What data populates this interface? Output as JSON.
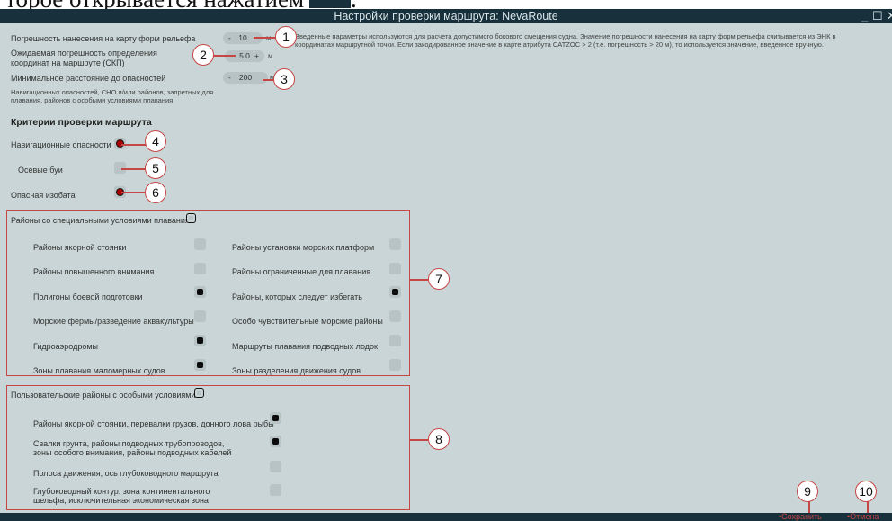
{
  "doc_text": "торое открывается нажатием",
  "window": {
    "title": "Настройки проверки маршрута: NevaRoute",
    "minimize": "_",
    "maximize": "☐",
    "close": "✕"
  },
  "params": {
    "relief": {
      "label": "Погрешность нанесения на карту форм рельефа",
      "value": "10",
      "unit": "м",
      "minus": "-",
      "plus": "+"
    },
    "position": {
      "label": "Ожидаемая погрешность определения координат на маршруте (СКП)",
      "value": "5.0",
      "unit": "м",
      "minus": "-",
      "plus": "+"
    },
    "distance": {
      "label": "Минимальное расстояние до опасностей",
      "value": "200",
      "unit": "м",
      "minus": "-",
      "plus": "+"
    },
    "distance_note": "Навигационных опасностей, СНО и/или районов, запретных для плавания, районов с особыми условиями плавания",
    "note": "Введенные параметры используются для расчета допустимого бокового смещения судна. Значение погрешности нанесения на карту форм рельефа считывается из ЭНК в координатах маршрутной точки. Если закодированное значение в карте атрибута CATZOC > 2 (т.е. погрешность > 20 м), то используется значение, введенное вручную."
  },
  "criteria": {
    "title": "Критерии проверки маршрута",
    "nav_hazards": "Навигационные опасности",
    "axial_buoys": "Осевые буи",
    "danger_isobath": "Опасная изобата"
  },
  "special_areas": {
    "title": "Районы со специальными условиями плавания",
    "items": [
      {
        "label": "Районы якорной стоянки",
        "checked": false
      },
      {
        "label": "Районы установки морских платформ",
        "checked": false
      },
      {
        "label": "Районы повышенного внимания",
        "checked": false
      },
      {
        "label": "Районы ограниченные для плавания",
        "checked": false
      },
      {
        "label": "Полигоны боевой подготовки",
        "checked": true
      },
      {
        "label": "Районы, которых следует избегать",
        "checked": true
      },
      {
        "label": "Морские фермы/разведение аквакультуры",
        "checked": false
      },
      {
        "label": "Особо чувствительные морские районы",
        "checked": false
      },
      {
        "label": "Гидроаэродромы",
        "checked": true
      },
      {
        "label": "Маршруты плавания подводных лодок",
        "checked": false
      },
      {
        "label": "Зоны плавания маломерных судов",
        "checked": true
      },
      {
        "label": "Зоны разделения движения судов",
        "checked": false
      }
    ]
  },
  "user_areas": {
    "title": "Пользовательские районы с особыми условиями",
    "items": [
      {
        "label": "Районы якорной стоянки, перевалки грузов, донного лова рыбы",
        "checked": true
      },
      {
        "label": "Свалки грунта, районы подводных трубопроводов, зоны особого внимания, районы подводных кабелей",
        "checked": true
      },
      {
        "label": "Полоса движения, ось глубоководного маршрута",
        "checked": false
      },
      {
        "label": "Глубоководный контур, зона континентального шельфа, исключительная экономическая зона",
        "checked": false
      }
    ]
  },
  "callouts": [
    "1",
    "2",
    "3",
    "4",
    "5",
    "6",
    "7",
    "8",
    "9",
    "10"
  ],
  "footer": {
    "save": "•Сохранить",
    "cancel": "•Отмена"
  },
  "colors": {
    "accent": "#c64545",
    "titlebar": "#17303b",
    "panel": "#c9d5d6"
  }
}
